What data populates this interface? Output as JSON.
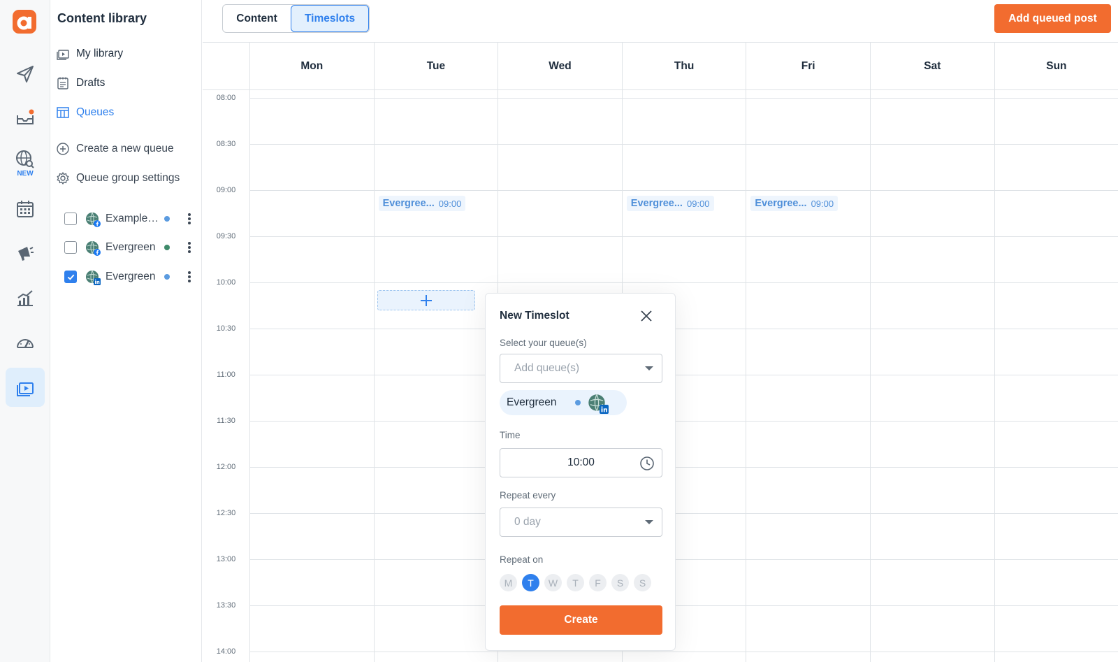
{
  "colors": {
    "accent": "#2f80ed",
    "brand_orange": "#f26c2f",
    "queue_dot_blue": "#5b9be0",
    "queue_dot_green": "#3f8a6a"
  },
  "rail": {
    "icons": [
      "logo-icon",
      "send-icon",
      "inbox-icon",
      "globe-search-icon",
      "calendar-icon",
      "megaphone-icon",
      "analytics-icon",
      "dashboard-gauge-icon",
      "content-library-icon"
    ],
    "new_tag": "NEW"
  },
  "library": {
    "title": "Content library",
    "items": [
      {
        "label": "My library",
        "icon": "library-icon"
      },
      {
        "label": "Drafts",
        "icon": "drafts-icon"
      },
      {
        "label": "Queues",
        "icon": "queues-icon",
        "active": true
      }
    ],
    "actions": [
      {
        "label": "Create a new queue",
        "icon": "plus-circle-icon"
      },
      {
        "label": "Queue group settings",
        "icon": "gear-icon"
      }
    ],
    "queues": [
      {
        "name": "Example queue",
        "checked": false,
        "dot": "#5b9be0",
        "network": "facebook"
      },
      {
        "name": "Evergreen",
        "checked": false,
        "dot": "#3f8a6a",
        "network": "facebook"
      },
      {
        "name": "Evergreen",
        "checked": true,
        "dot": "#5b9be0",
        "network": "linkedin"
      }
    ]
  },
  "topbar": {
    "tabs": [
      {
        "label": "Content"
      },
      {
        "label": "Timeslots",
        "active": true
      }
    ],
    "add_button": "Add queued post"
  },
  "calendar": {
    "days": [
      "Mon",
      "Tue",
      "Wed",
      "Thu",
      "Fri",
      "Sat",
      "Sun"
    ],
    "times": [
      "08:00",
      "08:30",
      "09:00",
      "09:30",
      "10:00",
      "10:30",
      "11:00",
      "11:30",
      "12:00",
      "12:30",
      "13:00",
      "13:30",
      "14:00"
    ],
    "slots": [
      {
        "day": "Tue",
        "name": "Evergree...",
        "time": "09:00"
      },
      {
        "day": "Thu",
        "name": "Evergree...",
        "time": "09:00"
      },
      {
        "day": "Fri",
        "name": "Evergree...",
        "time": "09:00"
      }
    ]
  },
  "popover": {
    "title": "New Timeslot",
    "queue_label": "Select your queue(s)",
    "queue_placeholder": "Add queue(s)",
    "selected_chip": "Evergreen",
    "time_label": "Time",
    "time_value": "10:00",
    "repeat_every_label": "Repeat every",
    "repeat_every_value": "0 day",
    "repeat_on_label": "Repeat on",
    "weekdays": [
      {
        "letter": "M",
        "on": false
      },
      {
        "letter": "T",
        "on": true
      },
      {
        "letter": "W",
        "on": false
      },
      {
        "letter": "T",
        "on": false
      },
      {
        "letter": "F",
        "on": false
      },
      {
        "letter": "S",
        "on": false
      },
      {
        "letter": "S",
        "on": false
      }
    ],
    "create_button": "Create"
  }
}
